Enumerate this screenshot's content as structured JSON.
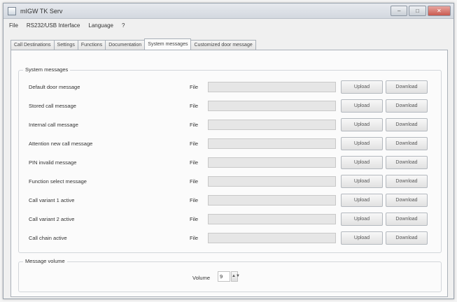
{
  "window": {
    "title": "mIGW TK Serv",
    "controls": {
      "minimize": "–",
      "maximize": "□",
      "close": "✕"
    }
  },
  "menu": [
    "File",
    "RS232/USB Interface",
    "Language",
    "?"
  ],
  "tabs": [
    "Call Destinations",
    "Settings",
    "Functions",
    "Documentation",
    "System messages",
    "Customized door message"
  ],
  "active_tab": 4,
  "system_messages": {
    "legend": "System messages",
    "file_label": "File",
    "upload_label": "Upload",
    "download_label": "Download",
    "rows": [
      {
        "label": "Default door message",
        "file": ""
      },
      {
        "label": "Stored call message",
        "file": ""
      },
      {
        "label": "Internal call message",
        "file": ""
      },
      {
        "label": "Attention new call message",
        "file": ""
      },
      {
        "label": "PIN invalid message",
        "file": ""
      },
      {
        "label": "Function select message",
        "file": ""
      },
      {
        "label": "Call variant 1 active",
        "file": ""
      },
      {
        "label": "Call variant 2 active",
        "file": ""
      },
      {
        "label": "Call chain active",
        "file": ""
      }
    ]
  },
  "message_volume": {
    "legend": "Message volume",
    "label": "Volume",
    "value": "9",
    "spin_glyph": "▲▼"
  }
}
